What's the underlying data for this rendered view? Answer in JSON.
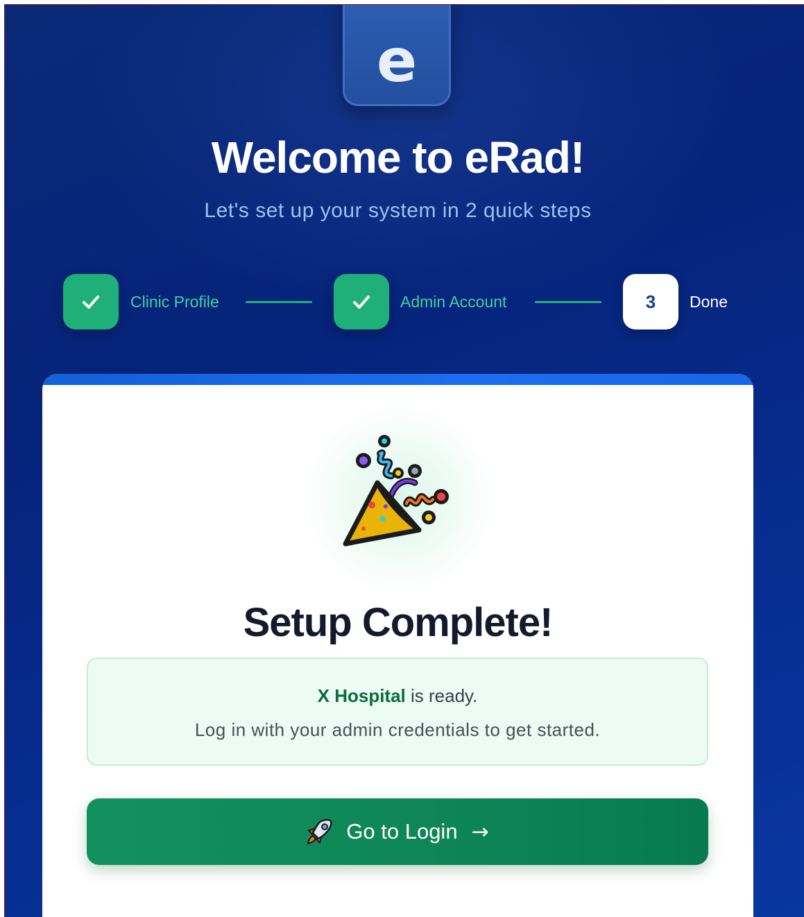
{
  "logo": {
    "letter": "e"
  },
  "header": {
    "title": "Welcome to eRad!",
    "subtitle": "Let's set up your system in 2 quick steps"
  },
  "steps": [
    {
      "label": "Clinic Profile",
      "state": "done",
      "icon": "check-icon"
    },
    {
      "label": "Admin Account",
      "state": "done",
      "icon": "check-icon"
    },
    {
      "label": "Done",
      "state": "current",
      "number": "3"
    }
  ],
  "card": {
    "icon": "party-popper-icon",
    "title": "Setup Complete!",
    "info": {
      "hospital_name": "X Hospital",
      "ready_text": " is ready.",
      "instructions": "Log in with your admin credentials to get started."
    },
    "button": {
      "icon": "rocket-icon",
      "label": "Go to Login",
      "arrow": "→"
    }
  },
  "colors": {
    "background": "#06237a",
    "accent_green": "#1fb07a",
    "button_green": "#0f8758",
    "card_topbar": "#1a6ff0"
  }
}
